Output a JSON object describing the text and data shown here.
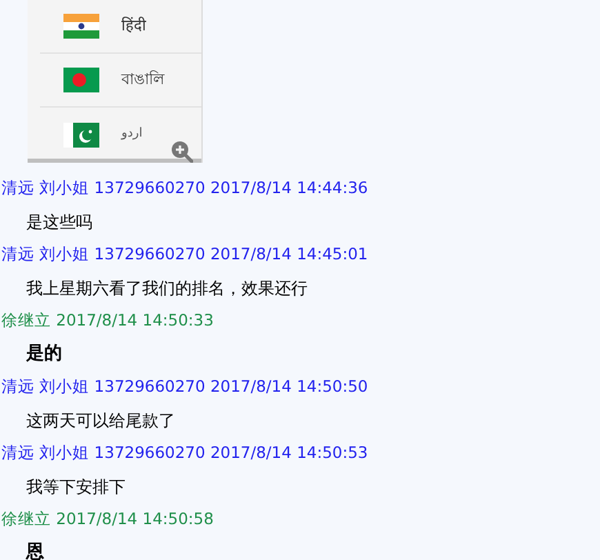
{
  "image": {
    "languages": [
      {
        "name": "हिंदी",
        "kind": "india"
      },
      {
        "name": "বাঙালি",
        "kind": "bangladesh"
      },
      {
        "name": "اردو",
        "kind": "pakistan"
      }
    ]
  },
  "messages": [
    {
      "kind": "customer",
      "header": "清远 刘小姐 13729660270 2017/8/14 14:44:36",
      "text": "是这些吗",
      "bold": false
    },
    {
      "kind": "customer",
      "header": "清远 刘小姐 13729660270 2017/8/14 14:45:01",
      "text": "我上星期六看了我们的排名，效果还行",
      "bold": false
    },
    {
      "kind": "staff",
      "header": "徐继立 2017/8/14 14:50:33",
      "text": "是的",
      "bold": true
    },
    {
      "kind": "customer",
      "header": "清远 刘小姐 13729660270 2017/8/14 14:50:50",
      "text": "这两天可以给尾款了",
      "bold": false
    },
    {
      "kind": "customer",
      "header": "清远 刘小姐 13729660270 2017/8/14 14:50:53",
      "text": "我等下安排下",
      "bold": false
    },
    {
      "kind": "staff",
      "header": "徐继立 2017/8/14 14:50:58",
      "text": "恩",
      "bold": true
    }
  ]
}
